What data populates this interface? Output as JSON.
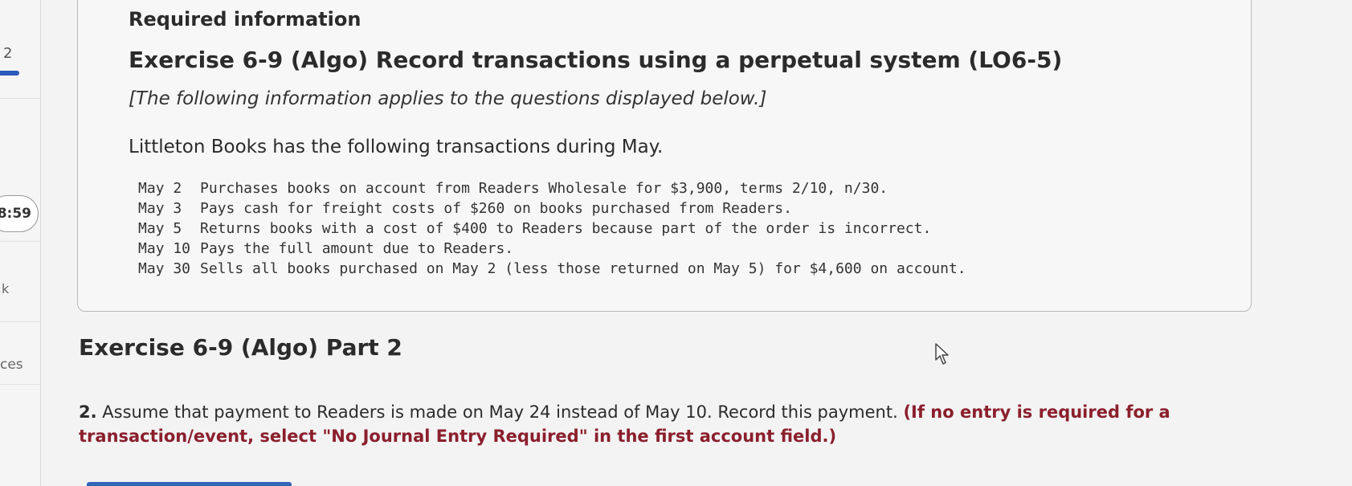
{
  "sidebar": {
    "question_number": "2",
    "timer": "8:59",
    "label_k": "k",
    "label_ces": "ces"
  },
  "required_info": {
    "heading": "Required information",
    "exercise_title": "Exercise 6-9 (Algo) Record transactions using a perpetual system (LO6-5)",
    "note": "[The following information applies to the questions displayed below.]",
    "intro": "Littleton Books has the following transactions during May.",
    "transactions": [
      {
        "date": "May 2",
        "text": "Purchases books on account from Readers Wholesale for $3,900, terms 2/10, n/30."
      },
      {
        "date": "May 3",
        "text": "Pays cash for freight costs of $260 on books purchased from Readers."
      },
      {
        "date": "May 5",
        "text": "Returns books with a cost of $400 to Readers because part of the order is incorrect."
      },
      {
        "date": "May 10",
        "text": "Pays the full amount due to Readers."
      },
      {
        "date": "May 30",
        "text": "Sells all books purchased on May 2 (less those returned on May 5) for $4,600 on account."
      }
    ]
  },
  "part": {
    "title": "Exercise 6-9 (Algo) Part 2"
  },
  "question": {
    "number": "2.",
    "text": " Assume that payment to Readers is made on May 24 instead of May 10. Record this payment. ",
    "instruction": "(If no entry is required for a transaction/event, select \"No Journal Entry Required\" in the first account field.)"
  },
  "colors": {
    "accent": "#3265b8",
    "instruction_text": "#8b1f2c"
  }
}
